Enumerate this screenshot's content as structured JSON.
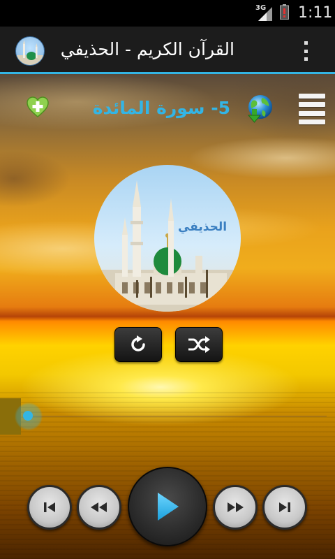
{
  "status_bar": {
    "network": "3G",
    "time": "1:11"
  },
  "action_bar": {
    "title": "القرآن الكريم - الحذيفي",
    "icons": {
      "app": "mosque-icon",
      "overflow": "overflow-menu-icon"
    }
  },
  "player": {
    "surah_title": "5- سورة المائدة",
    "reciter_name": "الحذيفي",
    "progress_fraction": 0.0,
    "icons": {
      "add_favorite": "heart-plus-icon",
      "download": "globe-download-icon",
      "playlist": "playlist-menu-icon",
      "repeat": "repeat-icon",
      "shuffle": "shuffle-icon",
      "previous": "skip-previous-icon",
      "rewind": "rewind-icon",
      "play": "play-icon",
      "forward": "fast-forward-icon",
      "next": "skip-next-icon"
    }
  },
  "colors": {
    "accent": "#33b5e5",
    "action_bar": "#1c1c1c",
    "status_bar": "#000000"
  }
}
